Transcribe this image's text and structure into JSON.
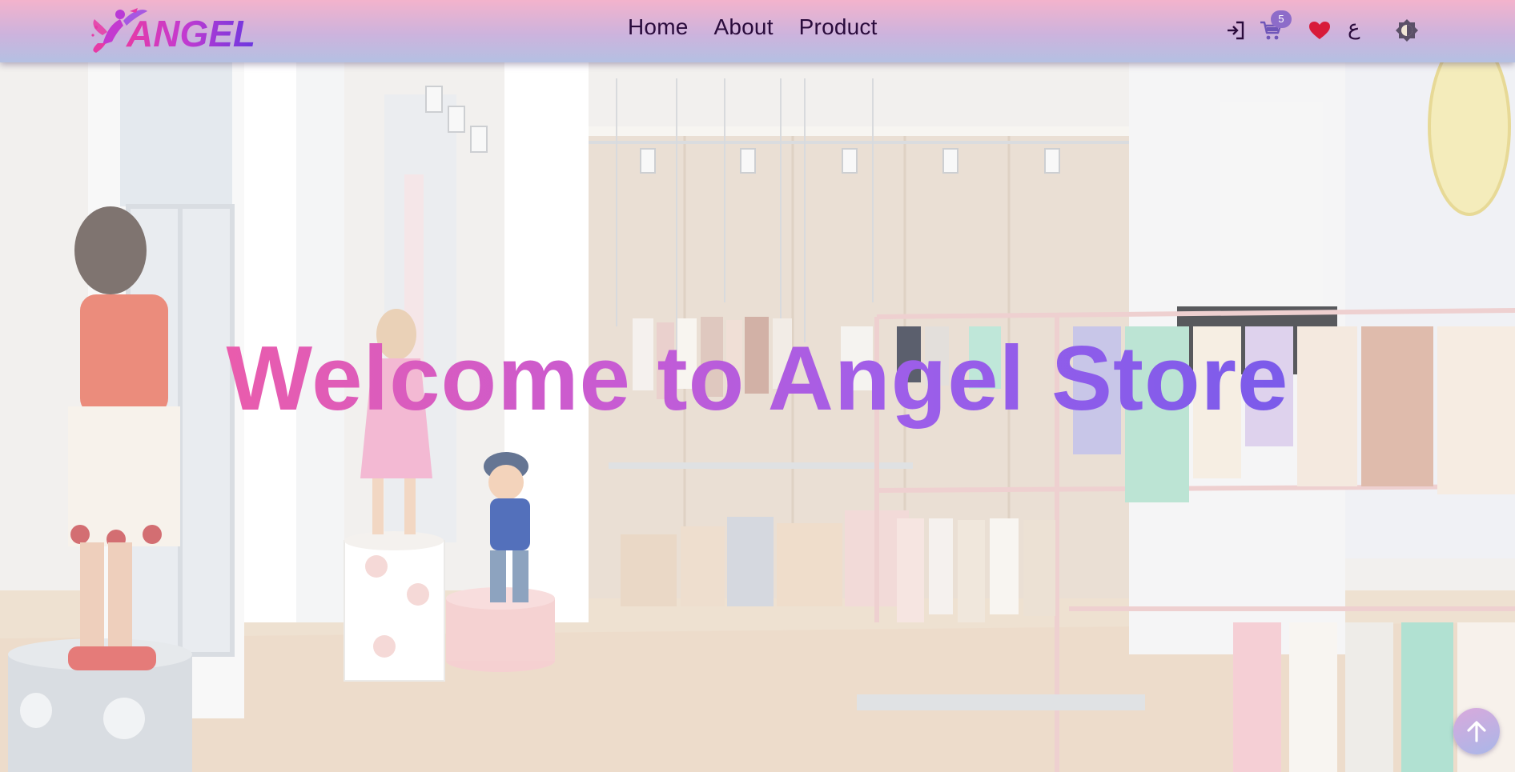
{
  "navbar": {
    "logo_text": "ANGEL",
    "links": [
      "Home",
      "About",
      "Product"
    ],
    "icons": {
      "login": "login-icon",
      "cart": "cart-icon",
      "wishlist": "heart-icon",
      "theme": "theme-toggle-icon"
    },
    "cart_count": "5",
    "language_toggle": "ع"
  },
  "hero": {
    "title": "Welcome to Angel Store",
    "background": "children-clothing-store-interior-photo"
  },
  "back_to_top": {
    "icon": "arrow-up-icon"
  },
  "colors": {
    "navbar_pink": "#f3b3cc",
    "navbar_blue": "#b4c0e2",
    "nav_text": "#2a0b3c",
    "title_pink": "#ea5cac",
    "title_purple": "#7a5bea",
    "badge": "#8d6cc9",
    "heart": "#d81b3a"
  }
}
